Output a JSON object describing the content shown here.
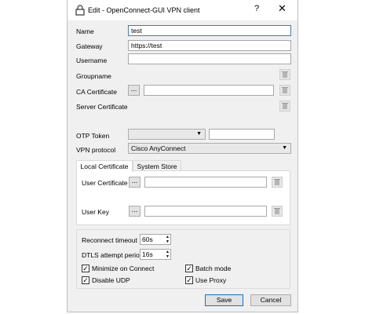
{
  "window": {
    "title": "Edit - OpenConnect-GUI VPN client",
    "help_glyph": "?",
    "close_glyph": "✕"
  },
  "form": {
    "name_label": "Name",
    "name_value": "test",
    "gateway_label": "Gateway",
    "gateway_value": "https://test",
    "username_label": "Username",
    "username_value": "",
    "groupname_label": "Groupname",
    "ca_cert_label": "CA Certificate",
    "server_cert_label": "Server Certificate",
    "otp_label": "OTP Token",
    "otp_type_value": "",
    "otp_secret_value": "",
    "vpn_protocol_label": "VPN protocol",
    "vpn_protocol_value": "Cisco AnyConnect",
    "browse_label": "..."
  },
  "tabs": [
    {
      "label": "Local Certificate",
      "active": true
    },
    {
      "label": "System Store",
      "active": false
    }
  ],
  "local_cert": {
    "user_cert_label": "User Certificate",
    "user_key_label": "User Key"
  },
  "options": {
    "reconnect_label": "Reconnect timeout",
    "reconnect_value": "60s",
    "dtls_label": "DTLS attempt period",
    "dtls_value": "16s",
    "minimize_label": "Minimize on Connect",
    "minimize_checked": true,
    "batch_label": "Batch mode",
    "batch_checked": true,
    "disable_udp_label": "Disable UDP",
    "disable_udp_checked": true,
    "use_proxy_label": "Use Proxy",
    "use_proxy_checked": true
  },
  "buttons": {
    "save": "Save",
    "cancel": "Cancel"
  },
  "icons": {
    "app": "lock-icon",
    "clear": "trash-icon"
  }
}
